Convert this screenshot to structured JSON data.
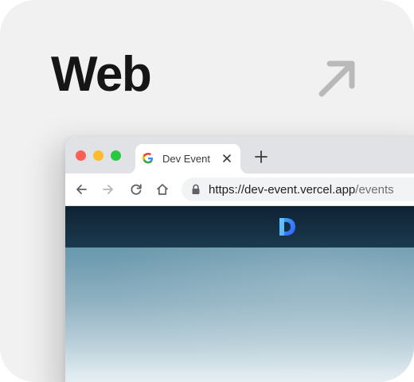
{
  "card": {
    "title": "Web",
    "arrow_icon": "arrow-up-right-icon"
  },
  "browser": {
    "tab": {
      "favicon": "google-g-icon",
      "title": "Dev Event",
      "close_icon": "close-icon"
    },
    "new_tab_icon": "plus-icon",
    "toolbar": {
      "back_icon": "arrow-left-icon",
      "forward_icon": "arrow-right-icon",
      "reload_icon": "reload-icon",
      "home_icon": "home-icon",
      "lock_icon": "lock-icon"
    },
    "address": {
      "host": "https://dev-event.vercel.app",
      "path": "/events"
    },
    "site": {
      "logo_icon": "dev-event-logo"
    }
  },
  "colors": {
    "card_bg": "#f1f1f1",
    "title": "#151515",
    "arrow": "#b9b9b9",
    "traffic_close": "#fd5d57",
    "traffic_minimize": "#fdbc2e",
    "traffic_maximize": "#28c941",
    "tabstrip": "#e0e2e6",
    "omnibox": "#f1f3f4",
    "site_header": "#0f2234",
    "logo": "#3aa0ff"
  }
}
